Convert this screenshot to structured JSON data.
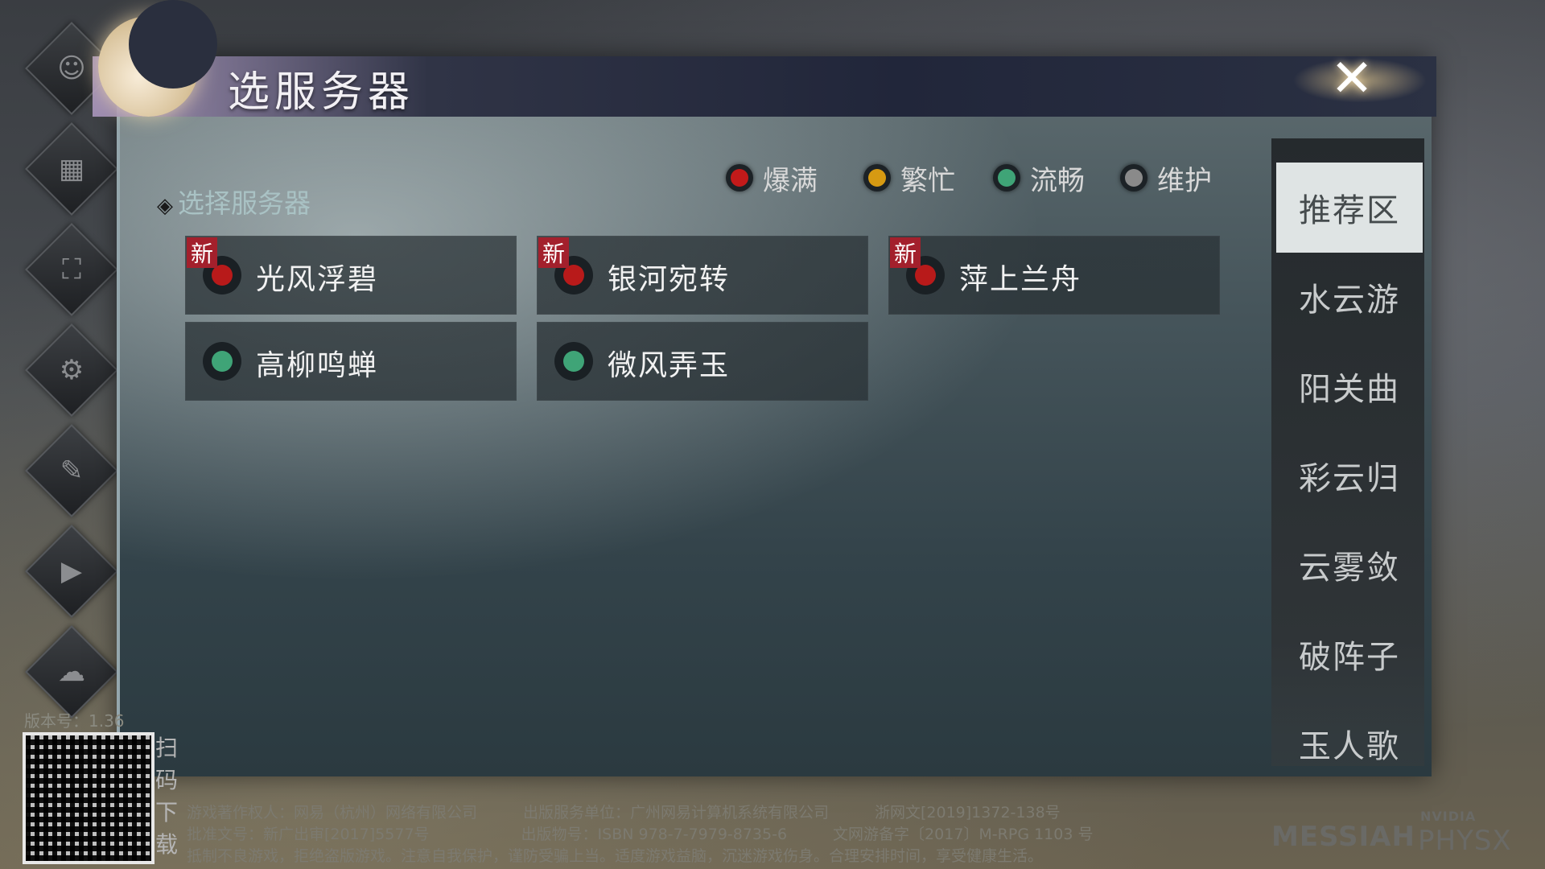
{
  "window": {
    "title": "选服务器",
    "close_label": "✕"
  },
  "left_menu": [
    {
      "icon": "character-icon",
      "glyph": "☺"
    },
    {
      "icon": "scroll-icon",
      "glyph": "▦"
    },
    {
      "icon": "fullscreen-icon",
      "glyph": "⛶"
    },
    {
      "icon": "settings-icon",
      "glyph": "⚙"
    },
    {
      "icon": "notes-icon",
      "glyph": "✎"
    },
    {
      "icon": "video-icon",
      "glyph": "▶"
    },
    {
      "icon": "cloud-icon",
      "glyph": "☁"
    }
  ],
  "section_label": "选择服务器",
  "legend": [
    {
      "label": "爆满",
      "color": "#c21a1a"
    },
    {
      "label": "繁忙",
      "color": "#d69a12"
    },
    {
      "label": "流畅",
      "color": "#3fa477"
    },
    {
      "label": "维护",
      "color": "#8a8a8a"
    }
  ],
  "servers": [
    {
      "name": "光风浮碧",
      "status": "爆满",
      "color": "#b81a1a",
      "new": "新"
    },
    {
      "name": "银河宛转",
      "status": "爆满",
      "color": "#b81a1a",
      "new": "新"
    },
    {
      "name": "萍上兰舟",
      "status": "爆满",
      "color": "#b81a1a",
      "new": "新"
    },
    {
      "name": "高柳鸣蝉",
      "status": "流畅",
      "color": "#3fa477",
      "new": ""
    },
    {
      "name": "微风弄玉",
      "status": "流畅",
      "color": "#3fa477",
      "new": ""
    }
  ],
  "tabs": [
    {
      "label": "推荐区",
      "active": true
    },
    {
      "label": "水云游",
      "active": false
    },
    {
      "label": "阳关曲",
      "active": false
    },
    {
      "label": "彩云归",
      "active": false
    },
    {
      "label": "云雾敛",
      "active": false
    },
    {
      "label": "破阵子",
      "active": false
    },
    {
      "label": "玉人歌",
      "active": false
    }
  ],
  "footer": {
    "version": "版本号：1.36",
    "qr_text": [
      "扫",
      "码",
      "下",
      "载"
    ],
    "legal_lines": [
      "游戏著作权人：网易（杭州）网络有限公司　　　出版服务单位：广州网易计算机系统有限公司　　　浙网文[2019]1372-138号",
      "批准文号：新广出审[2017]5577号　　　　　　出版物号：ISBN 978-7-7979-8735-6　　　文网游备字〔2017〕M-RPG 1103 号",
      "抵制不良游戏，拒绝盗版游戏。注意自我保护，谨防受骗上当。适度游戏益脑，沉迷游戏伤身。合理安排时间，享受健康生活。"
    ],
    "brand_left": "MESSIAH",
    "brand_right": "PHYSX",
    "brand_small": "NVIDIA"
  }
}
